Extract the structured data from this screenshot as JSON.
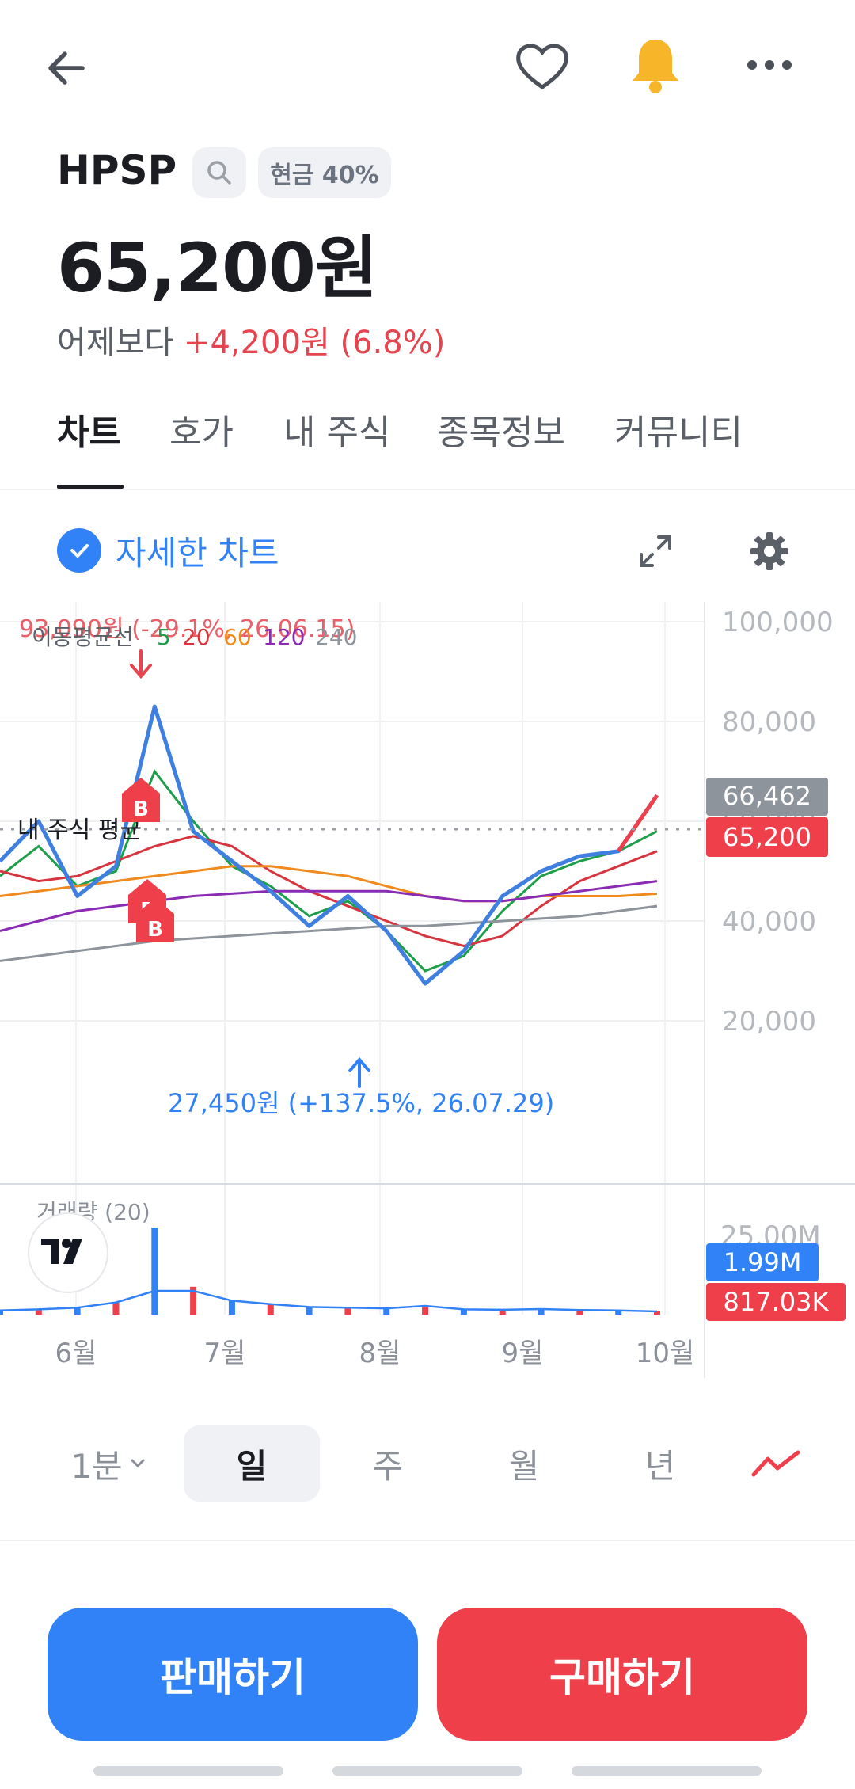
{
  "stock": {
    "name": "HPSP",
    "cash_tag": "현금 40%",
    "price": "65,200원",
    "change_prefix": "어제보다",
    "change": "+4,200원 (6.8%)"
  },
  "tabs": [
    {
      "label": "차트"
    },
    {
      "label": "호가"
    },
    {
      "label": "내 주식"
    },
    {
      "label": "종목정보"
    },
    {
      "label": "커뮤니티"
    }
  ],
  "detail_chart_label": "자세한 차트",
  "chart": {
    "high_annotation": "93,090원 (-29.1%, 26.06.15)",
    "low_annotation": "27,450원 (+137.5%, 26.07.29)",
    "ma_legend": {
      "title": "이동평균선",
      "items": [
        {
          "label": "5",
          "color": "#1e9e4a"
        },
        {
          "label": "20",
          "color": "#d6353f"
        },
        {
          "label": "60",
          "color": "#f08a1c"
        },
        {
          "label": "120",
          "color": "#8a2bb5"
        },
        {
          "label": "240",
          "color": "#8e949b"
        }
      ]
    },
    "avg_label": "내 주식 평균",
    "price_badges": {
      "avg": "66,462",
      "current": "65,200"
    },
    "y_ticks": [
      "100,000",
      "80,000",
      "60,000",
      "40,000",
      "20,000"
    ],
    "volume_title": "거래량 (20)",
    "volume_tick": "25.00M",
    "volume_badges": {
      "ma": "1.99M",
      "current": "817.03K"
    },
    "x_ticks": [
      "6월",
      "7월",
      "8월",
      "9월",
      "10월"
    ],
    "marker_labels": [
      "B",
      "F",
      "B"
    ]
  },
  "chart_data": {
    "type": "line",
    "title": "",
    "xlabel": "",
    "ylabel": "",
    "ylim": [
      0,
      100000
    ],
    "x": [
      "6월",
      "7월",
      "8월",
      "9월",
      "10월"
    ],
    "series": [
      {
        "name": "price",
        "values": [
          52000,
          60000,
          45000,
          51000,
          83000,
          58000,
          52000,
          46000,
          39000,
          45000,
          38000,
          27450,
          34000,
          45000,
          50000,
          53000,
          54000,
          65200
        ]
      },
      {
        "name": "5",
        "values": [
          49000,
          55000,
          47000,
          50000,
          70000,
          60000,
          51000,
          47000,
          41000,
          44000,
          38000,
          30000,
          33000,
          42000,
          49000,
          52000,
          54000,
          58000
        ]
      },
      {
        "name": "20",
        "values": [
          50000,
          48000,
          49000,
          52000,
          55000,
          57000,
          55000,
          50000,
          46000,
          43000,
          40000,
          37000,
          35000,
          37000,
          43000,
          48000,
          51000,
          54000
        ]
      },
      {
        "name": "60",
        "values": [
          45000,
          46000,
          47000,
          48000,
          49000,
          50000,
          51000,
          51000,
          50000,
          49000,
          47000,
          45000,
          44000,
          44000,
          45000,
          45000,
          45000,
          45500
        ]
      },
      {
        "name": "120",
        "values": [
          38000,
          40000,
          42000,
          43000,
          44000,
          45000,
          45500,
          46000,
          46000,
          46000,
          46000,
          45000,
          44000,
          44000,
          45000,
          46000,
          47000,
          48000
        ]
      },
      {
        "name": "240",
        "values": [
          32000,
          33000,
          34000,
          35000,
          36000,
          36500,
          37000,
          37500,
          38000,
          38500,
          39000,
          39000,
          39500,
          40000,
          40500,
          41000,
          42000,
          43000
        ]
      }
    ],
    "volume": [
      1.2,
      1.5,
      2.0,
      3.5,
      25.0,
      8.0,
      4.0,
      3.0,
      2.2,
      2.0,
      1.8,
      2.5,
      1.5,
      1.4,
      1.6,
      1.3,
      1.2,
      0.82
    ],
    "grid": true
  }
}
